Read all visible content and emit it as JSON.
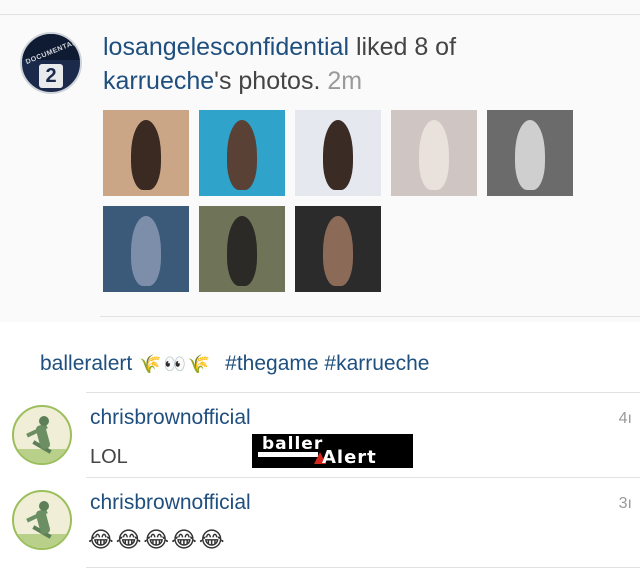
{
  "activity": {
    "user": "losangelesconfidential",
    "text_before": " liked 8 of",
    "target_user": "karrueche",
    "text_after": "'s photos.",
    "time": "2m",
    "avatar_badge_text": "DOCUMENTARY",
    "avatar_badge_number": "2",
    "photos": [
      {
        "bg": "#caa687",
        "fig": "#3b2a22"
      },
      {
        "bg": "#2fa3c9",
        "fig": "#5a4136"
      },
      {
        "bg": "#e6e8ef",
        "fig": "#3a2b25"
      },
      {
        "bg": "#cfc5c2",
        "fig": "#e9e1dc"
      },
      {
        "bg": "#6b6b6b",
        "fig": "#cfcfcf"
      },
      {
        "bg": "#3b5a7a",
        "fig": "#7d8eab"
      },
      {
        "bg": "#6f7357",
        "fig": "#2b2a26"
      },
      {
        "bg": "#2b2b2b",
        "fig": "#8b6a57"
      }
    ]
  },
  "caption": {
    "user": "balleralert",
    "emojis": [
      "🌾",
      "👀",
      "🌾"
    ],
    "hashtags": "#thegame #karrueche"
  },
  "comments": [
    {
      "user": "chrisbrownofficial",
      "text": "LOL",
      "time": "4ı"
    },
    {
      "user": "chrisbrownofficial",
      "text": "😂😂😂😂😂",
      "time": "3ı"
    }
  ],
  "watermark": {
    "line1": "baller",
    "line2": "Alert"
  },
  "colors": {
    "link": "#1f4f7e",
    "muted": "#9a9a9a",
    "separator": "#e2e2e2"
  }
}
